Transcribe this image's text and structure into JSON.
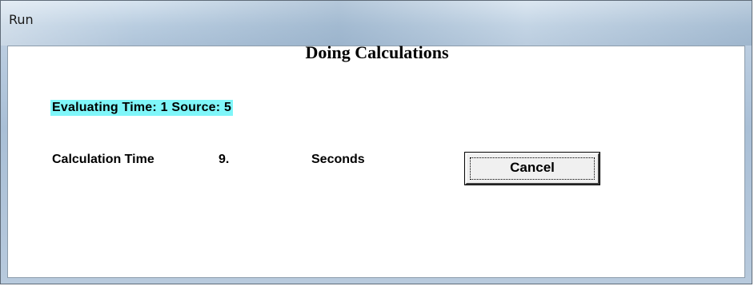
{
  "window": {
    "title": "Run"
  },
  "dialog": {
    "heading": "Doing Calculations",
    "status_text": "Evaluating Time: 1 Source: 5",
    "calc_time_label": "Calculation Time",
    "calc_time_value": "9.",
    "calc_time_unit": "Seconds",
    "cancel_label": "Cancel"
  },
  "colors": {
    "status_highlight": "#7ff6f9",
    "button_face": "#f0f0f0",
    "titlebar": "#b9cde0"
  }
}
